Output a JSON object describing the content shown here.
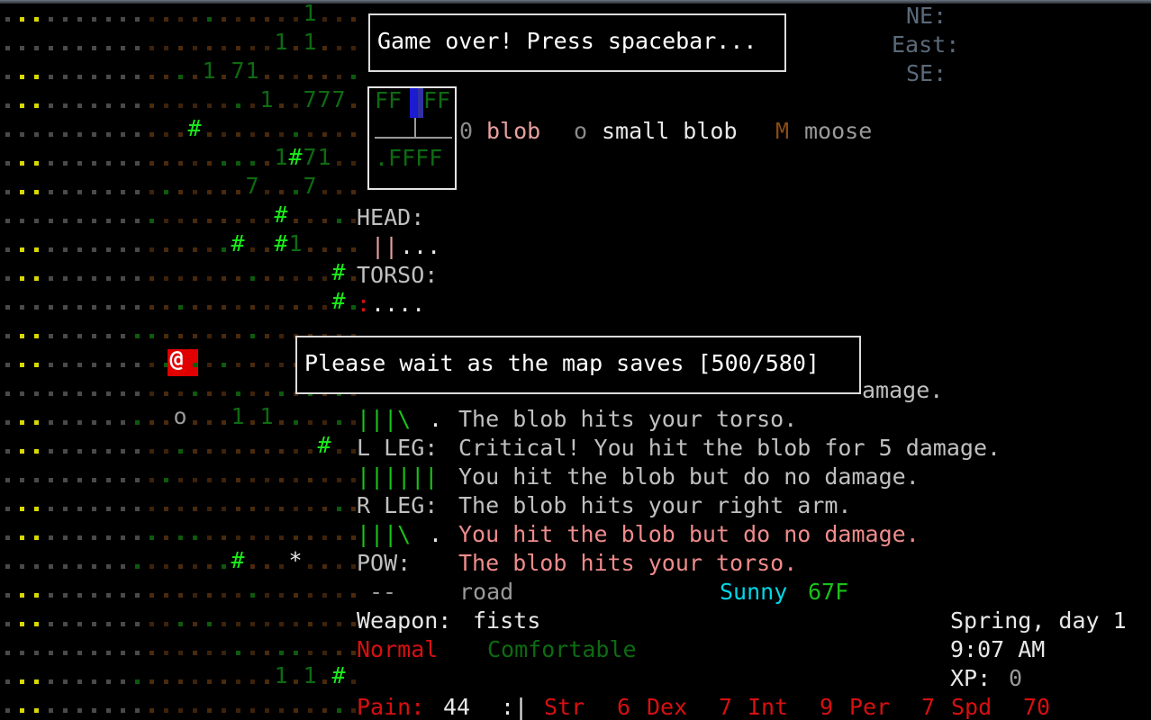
{
  "app": {
    "title": "Cataclysm: Dark Days Ahead",
    "kind": "roguelike-terminal"
  },
  "colors": {
    "background": "#000000",
    "accent_red": "#d81010",
    "player_highlight": "#e00000",
    "green": "#19c219",
    "dark_green": "#0d6b12",
    "yellow": "#d8d800",
    "cyan": "#00d8e8",
    "pink": "#e8a0a0",
    "white": "#e8e8e8",
    "gray": "#9a9a9a",
    "brown": "#6b3b13",
    "blue": "#1b1bd0"
  },
  "dialogs": {
    "game_over": {
      "text": "Game over! Press spacebar..."
    },
    "map_save": {
      "text": "Please wait as the map saves [500/580]"
    }
  },
  "compass": {
    "ne_label": "NE:",
    "east_label": "East:",
    "se_label": "SE:"
  },
  "minimap": {
    "row1": "FF",
    "row1b": "FF",
    "row2": ".FFFF"
  },
  "legend": {
    "entries": [
      {
        "glyph": "0",
        "name": "blob"
      },
      {
        "glyph": "o",
        "name": "small blob"
      },
      {
        "glyph": "M",
        "name": "moose"
      }
    ]
  },
  "body_parts": [
    {
      "label": "HEAD:",
      "bar": "||...",
      "bar_state": "damaged"
    },
    {
      "label": "TORSO:",
      "bar": ":....",
      "bar_state": "critical"
    },
    {
      "label": "",
      "bar": "|||\\.",
      "bar_state": "ok"
    },
    {
      "label": "L LEG:",
      "bar": "",
      "bar_state": "ok"
    },
    {
      "label": "",
      "bar": "||||||",
      "bar_state": "ok"
    },
    {
      "label": "R LEG:",
      "bar": "",
      "bar_state": "ok"
    },
    {
      "label": "",
      "bar": "|||\\.",
      "bar_state": "ok"
    },
    {
      "label": "POW:",
      "bar": "",
      "bar_state": "ok"
    }
  ],
  "messages": [
    {
      "text": "amage.",
      "color": "white",
      "partial": true
    },
    {
      "text": "The blob hits your torso.",
      "color": "white"
    },
    {
      "text": "Critical! You hit the blob for 5 damage.",
      "color": "white"
    },
    {
      "text": "You hit the blob but do no damage.",
      "color": "white"
    },
    {
      "text": "The blob hits your right arm.",
      "color": "white"
    },
    {
      "text": "You hit the blob but do no damage.",
      "color": "pink"
    },
    {
      "text": "The blob hits your torso.",
      "color": "pink"
    }
  ],
  "status": {
    "terrain_dashes": "--",
    "terrain_name": "road",
    "weather": "Sunny",
    "temperature": "67F",
    "weapon_label": "Weapon:",
    "weapon_value": "fists",
    "moral_state": "Normal",
    "comfort_state": "Comfortable",
    "season_day": "Spring, day 1",
    "time": "9:07 AM",
    "xp_label": "XP:",
    "xp_value": "0",
    "pain_label": "Pain:",
    "pain_value": "44",
    "face": ":|",
    "stats": [
      {
        "name": "Str",
        "value": "6"
      },
      {
        "name": "Dex",
        "value": "7"
      },
      {
        "name": "Int",
        "value": "9"
      },
      {
        "name": "Per",
        "value": "7"
      },
      {
        "name": "Spd",
        "value": "70"
      }
    ]
  },
  "map": {
    "player_glyph": "@",
    "rows": [
      {
        "y": 0,
        "overlay": [
          {
            "x": 21,
            "ch": "1",
            "c": "dkgreen"
          }
        ]
      },
      {
        "y": 1,
        "overlay": [
          {
            "x": 19,
            "ch": "1",
            "c": "dkgreen"
          },
          {
            "x": 21,
            "ch": "1",
            "c": "dkgreen"
          }
        ]
      },
      {
        "y": 2,
        "overlay": [
          {
            "x": 14,
            "ch": "1",
            "c": "dkgreen"
          },
          {
            "x": 16,
            "ch": "7",
            "c": "dkgreen"
          },
          {
            "x": 17,
            "ch": "1",
            "c": "dkgreen"
          }
        ]
      },
      {
        "y": 3,
        "overlay": [
          {
            "x": 18,
            "ch": "1",
            "c": "dkgreen"
          },
          {
            "x": 21,
            "ch": "7",
            "c": "dkgreen"
          },
          {
            "x": 22,
            "ch": "7",
            "c": "dkgreen"
          },
          {
            "x": 23,
            "ch": "7",
            "c": "dkgreen"
          }
        ]
      },
      {
        "y": 4,
        "overlay": [
          {
            "x": 13,
            "ch": "#",
            "c": "brightgreen"
          }
        ]
      },
      {
        "y": 5,
        "overlay": [
          {
            "x": 19,
            "ch": "1",
            "c": "dkgreen"
          },
          {
            "x": 20,
            "ch": "#",
            "c": "brightgreen"
          },
          {
            "x": 21,
            "ch": "7",
            "c": "dkgreen"
          },
          {
            "x": 22,
            "ch": "1",
            "c": "dkgreen"
          }
        ]
      },
      {
        "y": 6,
        "overlay": [
          {
            "x": 17,
            "ch": "7",
            "c": "dkgreen"
          },
          {
            "x": 21,
            "ch": "7",
            "c": "dkgreen"
          }
        ]
      },
      {
        "y": 7,
        "overlay": [
          {
            "x": 19,
            "ch": "#",
            "c": "brightgreen"
          }
        ]
      },
      {
        "y": 8,
        "overlay": [
          {
            "x": 16,
            "ch": "#",
            "c": "brightgreen"
          },
          {
            "x": 19,
            "ch": "#",
            "c": "brightgreen"
          },
          {
            "x": 20,
            "ch": "1",
            "c": "dkgreen"
          }
        ]
      },
      {
        "y": 9,
        "overlay": [
          {
            "x": 23,
            "ch": "#",
            "c": "brightgreen"
          }
        ]
      },
      {
        "y": 10,
        "overlay": [
          {
            "x": 23,
            "ch": "#",
            "c": "brightgreen"
          }
        ]
      },
      {
        "y": 11,
        "overlay": []
      },
      {
        "y": 12,
        "overlay": [
          {
            "x": 12,
            "ch": "@",
            "c": "player"
          }
        ]
      },
      {
        "y": 13,
        "overlay": []
      },
      {
        "y": 14,
        "overlay": [
          {
            "x": 12,
            "ch": "o",
            "c": "gray"
          },
          {
            "x": 16,
            "ch": "1",
            "c": "dkgreen"
          },
          {
            "x": 18,
            "ch": "1",
            "c": "dkgreen"
          }
        ]
      },
      {
        "y": 15,
        "overlay": [
          {
            "x": 22,
            "ch": "#",
            "c": "brightgreen"
          }
        ]
      },
      {
        "y": 16,
        "overlay": []
      },
      {
        "y": 17,
        "overlay": []
      },
      {
        "y": 18,
        "overlay": []
      },
      {
        "y": 19,
        "overlay": [
          {
            "x": 16,
            "ch": "#",
            "c": "brightgreen"
          },
          {
            "x": 20,
            "ch": "*",
            "c": "white"
          }
        ]
      },
      {
        "y": 20,
        "overlay": []
      },
      {
        "y": 21,
        "overlay": []
      },
      {
        "y": 22,
        "overlay": []
      },
      {
        "y": 23,
        "overlay": [
          {
            "x": 19,
            "ch": "1",
            "c": "dkgreen"
          },
          {
            "x": 21,
            "ch": "1",
            "c": "dkgreen"
          },
          {
            "x": 23,
            "ch": "#",
            "c": "brightgreen"
          }
        ]
      },
      {
        "y": 24,
        "overlay": []
      }
    ]
  }
}
